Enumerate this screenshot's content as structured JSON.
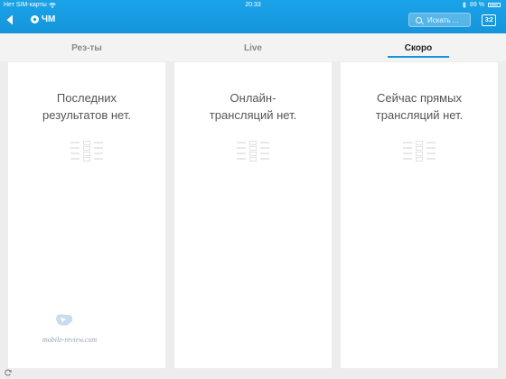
{
  "status_bar": {
    "carrier": "Нет SIM-карты",
    "time": "20:33",
    "battery": "89 %"
  },
  "header": {
    "title": "ЧМ",
    "search_placeholder": "Искать ...",
    "score_icon_label": "3:2",
    "accent_color": "#1595db"
  },
  "tabs": [
    {
      "label": "Рез-ты",
      "active": false
    },
    {
      "label": "Live",
      "active": false
    },
    {
      "label": "Скоро",
      "active": true
    }
  ],
  "panels": [
    {
      "line1": "Последних",
      "line2": "результатов нет."
    },
    {
      "line1": "Онлайн-",
      "line2": "трансляций нет."
    },
    {
      "line1": "Сейчас прямых",
      "line2": "трансляций нет."
    }
  ],
  "watermark": "mobile-review.com"
}
